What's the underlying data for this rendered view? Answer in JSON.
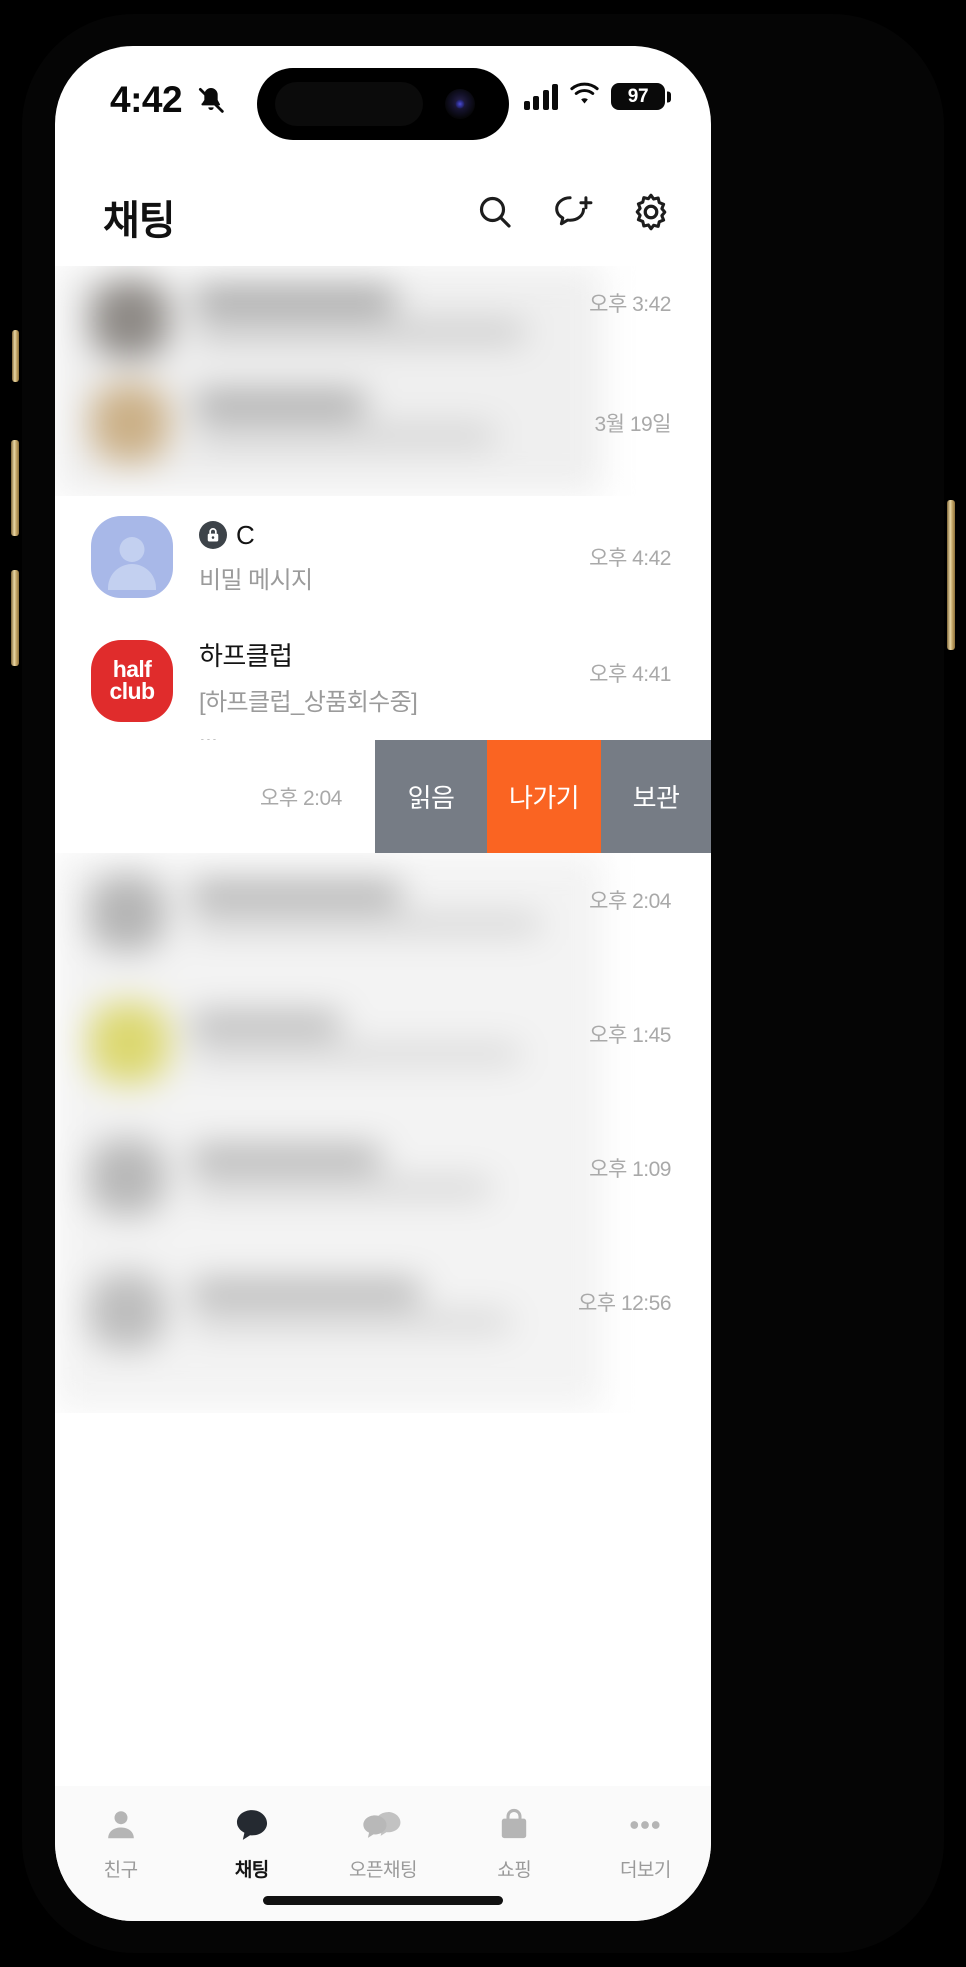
{
  "status_bar": {
    "time": "4:42",
    "bell_icon": "bell-slash-icon",
    "signal_icon": "cellular-signal-icon",
    "wifi_icon": "wifi-icon",
    "battery_percent": "97"
  },
  "header": {
    "title": "채팅",
    "icons": [
      {
        "name": "search-icon",
        "label": "검색"
      },
      {
        "name": "new-chat-icon",
        "label": "새 채팅"
      },
      {
        "name": "gear-icon",
        "label": "설정"
      }
    ]
  },
  "chat_list": {
    "hidden_times": [
      "오후 3:42",
      "3월 19일"
    ],
    "rows": [
      {
        "avatar": "person-avatar",
        "lock_icon": "lock-icon",
        "name": "C",
        "message": "비밀 메시지",
        "time": "오후 4:42"
      },
      {
        "avatar": "halfclub-logo",
        "logo_line1": "half",
        "logo_line2": "club",
        "name": "하프클럽",
        "message": "[하프클럽_상품회수중]",
        "message_overflow": "...",
        "time": "오후 4:41"
      }
    ],
    "swipe_row": {
      "time": "오후 2:04",
      "actions": [
        {
          "label": "읽음",
          "color": "#767c85"
        },
        {
          "label": "나가기",
          "color": "#fa6422"
        },
        {
          "label": "보관",
          "color": "#767c85"
        }
      ]
    },
    "blurred_times": [
      "오후 2:04",
      "오후 1:45",
      "오후 1:09",
      "오후 12:56"
    ]
  },
  "tabbar": {
    "tabs": [
      {
        "label": "친구",
        "icon": "person-icon",
        "active": false
      },
      {
        "label": "채팅",
        "icon": "chat-bubble-icon",
        "active": true
      },
      {
        "label": "오픈채팅",
        "icon": "open-chat-icon",
        "active": false
      },
      {
        "label": "쇼핑",
        "icon": "shopping-bag-icon",
        "active": false
      },
      {
        "label": "더보기",
        "icon": "more-dots-icon",
        "active": false
      }
    ]
  },
  "colors": {
    "accent_orange": "#fa6422",
    "action_gray": "#767c85",
    "halfclub_red": "#e02c2c",
    "avatar_blue": "#a8b8e8"
  }
}
